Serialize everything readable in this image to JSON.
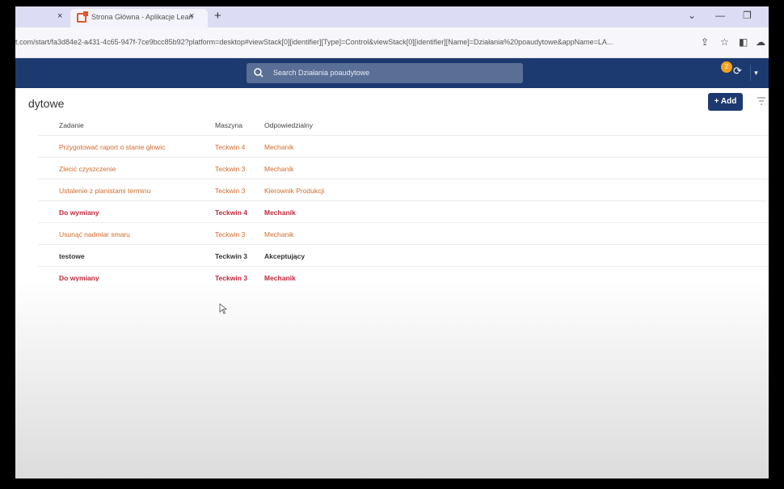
{
  "browser": {
    "tab_title": "Strona Główna - Aplikacje Lean",
    "tab_close_left": "×",
    "tab_close": "×",
    "new_tab": "+",
    "url": "t.com/start/fa3d84e2-a431-4c65-947f-7ce9bcc85b92?platform=desktop#viewStack[0][identifier][Type]=Control&viewStack[0][identifier][Name]=Działania%20poaudytowe&appName=LA...",
    "minimize": "—",
    "restore": "❐"
  },
  "header": {
    "search_placeholder": "Search Działania poaudytowe",
    "notification_count": "2"
  },
  "page": {
    "title": "dytowe",
    "add_label": "+ Add"
  },
  "table": {
    "columns": [
      "Zadanie",
      "Maszyna",
      "Odpowiedzialny"
    ],
    "rows": [
      {
        "zadanie": "Przygotować raport o stanie głowic",
        "maszyna": "Teckwin 4",
        "odpowiedzialny": "Mechanik",
        "style": "orange"
      },
      {
        "zadanie": "Zlecić czyszczenie",
        "maszyna": "Teckwin 3",
        "odpowiedzialny": "Mechanik",
        "style": "orange"
      },
      {
        "zadanie": "Ustalenie z planistami terminu",
        "maszyna": "Teckwin 3",
        "odpowiedzialny": "Kierownik Produkcji",
        "style": "orange"
      },
      {
        "zadanie": "Do wymiany",
        "maszyna": "Teckwin 4",
        "odpowiedzialny": "Mechanik",
        "style": "red"
      },
      {
        "zadanie": "Usunąć nadmiar smaru",
        "maszyna": "Teckwin 3",
        "odpowiedzialny": "Mechanik",
        "style": "orange"
      },
      {
        "zadanie": "testowe",
        "maszyna": "Teckwin 3",
        "odpowiedzialny": "Akceptujący",
        "style": "dark"
      },
      {
        "zadanie": "Do wymiany",
        "maszyna": "Teckwin 3",
        "odpowiedzialny": "Mechanik",
        "style": "red"
      }
    ]
  },
  "colors": {
    "appbar": "#1c3a70",
    "orange_text": "#d26a2c",
    "red_text": "#c0273b",
    "badge": "#f2a21d"
  }
}
